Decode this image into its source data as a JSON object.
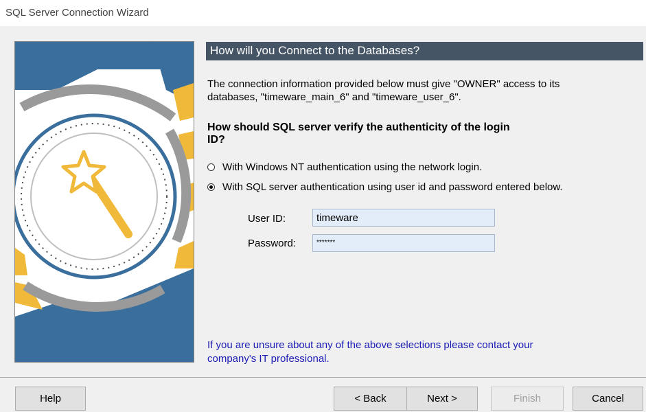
{
  "window": {
    "title": "SQL Server Connection Wizard"
  },
  "header": {
    "title": "How will you Connect to the Databases?"
  },
  "info": {
    "line1": "The connection information provided below must give \"OWNER\" access to its",
    "line2": "databases, \"timeware_main_6\" and \"timeware_user_6\"."
  },
  "question": {
    "line1": "How should SQL server verify the authenticity of the login",
    "line2": "ID?"
  },
  "auth_options": [
    {
      "label": "With Windows NT authentication using the network login.",
      "selected": false
    },
    {
      "label": "With SQL server authentication using user id and password entered below.",
      "selected": true
    }
  ],
  "form": {
    "user_id_label": "User ID:",
    "user_id_value": "timeware",
    "password_label": "Password:",
    "password_value": "*******"
  },
  "footer_note": {
    "line1": "If you are unsure about any of the above selections please contact your",
    "line2": "company's IT professional."
  },
  "buttons": {
    "help": "Help",
    "back": "< Back",
    "next": "Next >",
    "finish": "Finish",
    "cancel": "Cancel"
  },
  "colors": {
    "header_bar": "#455566",
    "accent_blue": "#3a6e9c",
    "accent_gold": "#f0b93a",
    "link_text": "#1a1ab4"
  },
  "icons": {
    "art": "magic-wand-clock-illustration"
  }
}
